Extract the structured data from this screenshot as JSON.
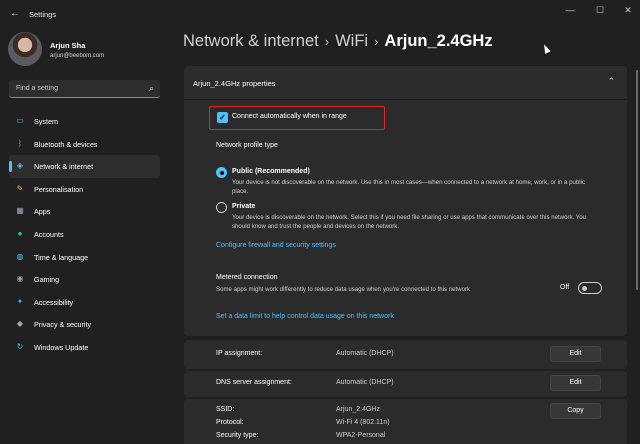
{
  "window": {
    "title": "Settings",
    "back_glyph": "←",
    "minimize_glyph": "—",
    "maximize_glyph": "☐",
    "close_glyph": "✕"
  },
  "user": {
    "name": "Arjun Sha",
    "email": "arjun@beebom.com"
  },
  "search": {
    "placeholder": "Find a setting",
    "icon": "search-icon",
    "glyph": "⌕"
  },
  "sidebar": {
    "items": [
      {
        "label": "System",
        "icon": "monitor-icon",
        "glyph": "▭",
        "color": "#4cc2ff",
        "active": false
      },
      {
        "label": "Bluetooth & devices",
        "icon": "bluetooth-icon",
        "glyph": "ᛒ",
        "color": "#4c9dff",
        "active": false
      },
      {
        "label": "Network & internet",
        "icon": "wifi-icon",
        "glyph": "◈",
        "color": "#4cc2ff",
        "active": true
      },
      {
        "label": "Personalisation",
        "icon": "brush-icon",
        "glyph": "✎",
        "color": "#f7a34a",
        "active": false
      },
      {
        "label": "Apps",
        "icon": "apps-icon",
        "glyph": "▦",
        "color": "#9aa7b8",
        "active": false
      },
      {
        "label": "Accounts",
        "icon": "person-icon",
        "glyph": "●",
        "color": "#2ecc71",
        "active": false
      },
      {
        "label": "Time & language",
        "icon": "globe-icon",
        "glyph": "◍",
        "color": "#4cc2ff",
        "active": false
      },
      {
        "label": "Gaming",
        "icon": "gamepad-icon",
        "glyph": "◉",
        "color": "#a0a0a0",
        "active": false
      },
      {
        "label": "Accessibility",
        "icon": "accessibility-icon",
        "glyph": "✦",
        "color": "#4c9dff",
        "active": false
      },
      {
        "label": "Privacy & security",
        "icon": "shield-icon",
        "glyph": "◆",
        "color": "#9aa7b8",
        "active": false
      },
      {
        "label": "Windows Update",
        "icon": "update-icon",
        "glyph": "↻",
        "color": "#4cc2ff",
        "active": false
      }
    ]
  },
  "header": {
    "crumb1": "Network & internet",
    "crumb2": "WiFi",
    "crumb3": "Arjun_2.4GHz",
    "separator": "›"
  },
  "properties": {
    "title": "Arjun_2.4GHz properties",
    "collapse_glyph": "⌃",
    "connect_auto": {
      "label": "Connect automatically when in range",
      "checked": true,
      "check_glyph": "✓"
    },
    "profile_type_label": "Network profile type",
    "public": {
      "title": "Public (Recommended)",
      "desc": "Your device is not discoverable on the network. Use this in most cases—when connected to a network at home, work, or in a public place.",
      "selected": true
    },
    "private": {
      "title": "Private",
      "desc": "Your device is discoverable on the network. Select this if you need file sharing or use apps that communicate over this network. You should know and trust the people and devices on the network.",
      "selected": false
    },
    "firewall_link": "Configure firewall and security settings",
    "metered": {
      "label": "Metered connection",
      "desc": "Some apps might work differently to reduce data usage when you're connected to this network",
      "state": "Off"
    },
    "data_limit_link": "Set a data limit to help control data usage on this network"
  },
  "ip": {
    "label": "IP assignment:",
    "value": "Automatic (DHCP)",
    "button": "Edit"
  },
  "dns": {
    "label": "DNS server assignment:",
    "value": "Automatic (DHCP)",
    "button": "Edit"
  },
  "details": {
    "ssid_label": "SSID:",
    "ssid_value": "Arjun_2.4GHz",
    "protocol_label": "Protocol:",
    "protocol_value": "Wi-Fi 4 (802.11n)",
    "security_label": "Security type:",
    "security_value": "WPA2-Personal",
    "copy_button": "Copy"
  }
}
